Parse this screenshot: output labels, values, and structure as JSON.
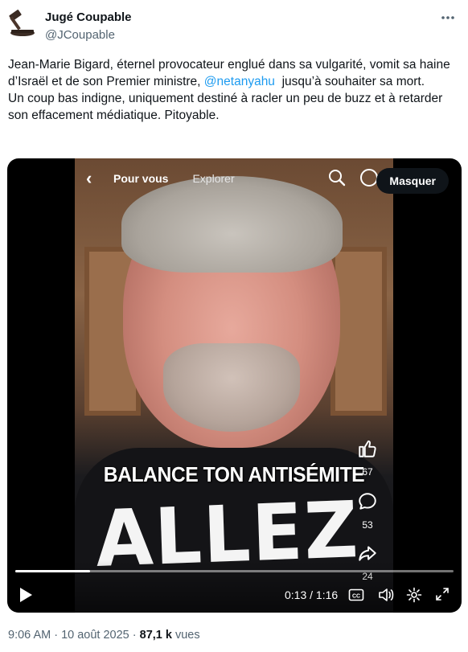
{
  "author": {
    "display_name": "Jugé Coupable",
    "handle": "@JCoupable",
    "avatar_icon": "gavel-icon"
  },
  "more_icon": "more-horizontal-icon",
  "tweet": {
    "text_part1": "Jean-Marie Bigard, éternel provocateur englué dans sa vulgarité, vomit sa haine d’Israël et de son Premier ministre,",
    "mention": "@netanyahu",
    "text_part2": "jusqu’à souhaiter sa mort.",
    "text_line2": "Un coup bas indigne, uniquement destiné à racler un peu de buzz et à retarder son effacement médiatique. Pitoyable."
  },
  "video": {
    "tiktok_tabs": [
      "Pour vous",
      "Explorer"
    ],
    "caption": "BALANCE TON ANTISÉMITE",
    "shirt_text": "ALLEZ",
    "likes": "67",
    "comments": "53",
    "shares": "24",
    "hide_button": "Masquer",
    "time_current": "0:13",
    "time_total": "1:16",
    "progress_fraction": 0.171
  },
  "footer": {
    "timestamp": "9:06 AM · 10 août 2025 · ",
    "views_count": "87,1 k",
    "views_label": " vues"
  }
}
